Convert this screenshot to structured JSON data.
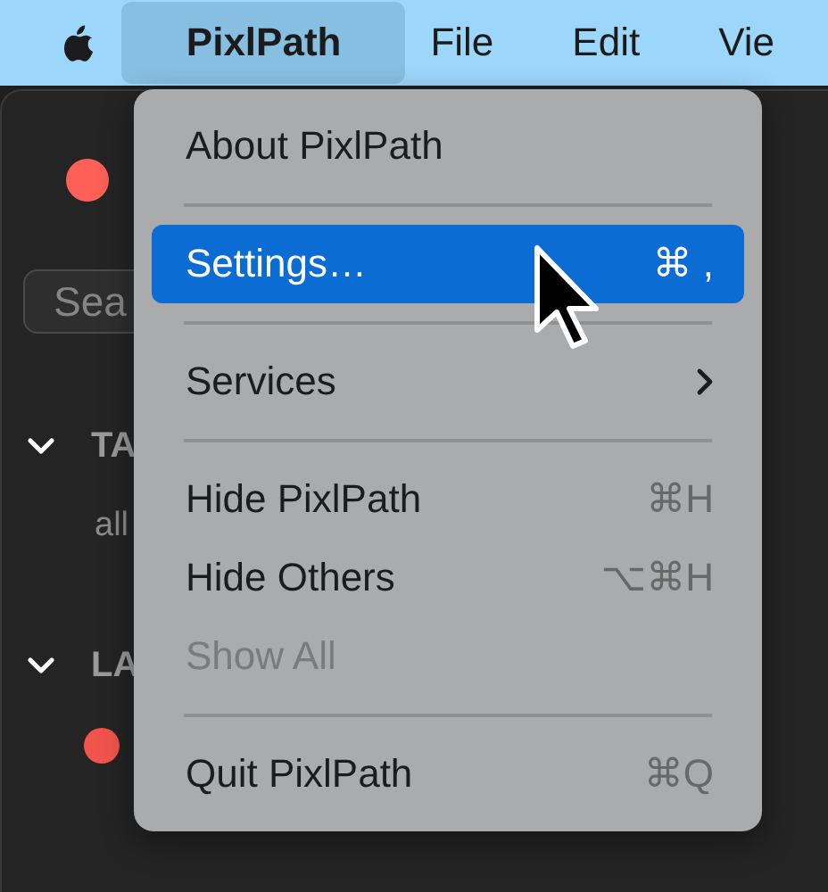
{
  "menubar": {
    "items": [
      {
        "label": "PixlPath",
        "kind": "app",
        "selected": true
      },
      {
        "label": "File",
        "kind": "menu",
        "selected": false
      },
      {
        "label": "Edit",
        "kind": "menu",
        "selected": false
      },
      {
        "label": "Vie",
        "kind": "menu",
        "selected": false
      }
    ]
  },
  "window": {
    "search": {
      "placeholder": "Sea"
    },
    "sections": [
      {
        "title": "TA",
        "expanded": true,
        "items": [
          {
            "label": "all"
          }
        ]
      },
      {
        "title": "LA",
        "expanded": true,
        "items": [
          {
            "color": "#f0544c"
          }
        ]
      }
    ]
  },
  "menu": {
    "items": [
      {
        "kind": "item",
        "label": "About PixlPath",
        "selected": false,
        "disabled": false
      },
      {
        "kind": "separator"
      },
      {
        "kind": "item",
        "label": "Settings…",
        "shortcut": "⌘ ,",
        "selected": true,
        "disabled": false
      },
      {
        "kind": "separator"
      },
      {
        "kind": "submenu",
        "label": "Services",
        "selected": false,
        "disabled": false
      },
      {
        "kind": "separator"
      },
      {
        "kind": "item",
        "label": "Hide PixlPath",
        "shortcut": "⌘H",
        "selected": false,
        "disabled": false
      },
      {
        "kind": "item",
        "label": "Hide Others",
        "shortcut": "⌥⌘H",
        "selected": false,
        "disabled": false
      },
      {
        "kind": "item",
        "label": "Show All",
        "selected": false,
        "disabled": true
      },
      {
        "kind": "separator"
      },
      {
        "kind": "item",
        "label": "Quit PixlPath",
        "shortcut": "⌘Q",
        "selected": false,
        "disabled": false
      }
    ]
  }
}
